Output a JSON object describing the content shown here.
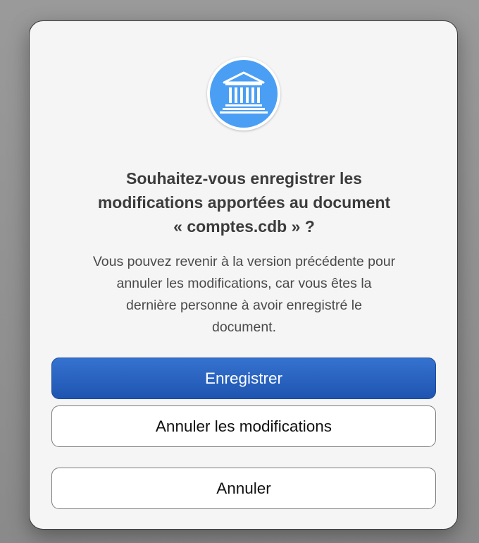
{
  "dialog": {
    "title": "Souhaitez-vous enregistrer les\nmodifications apportées au document\n« comptes.cdb » ?",
    "message": "Vous pouvez revenir à la version précédente pour\nannuler les modifications, car vous êtes la\ndernière personne à avoir enregistré le\ndocument.",
    "icon": "bank-building-icon",
    "buttons": {
      "save": "Enregistrer",
      "discard": "Annuler les modifications",
      "cancel": "Annuler"
    }
  },
  "colors": {
    "accent": "#2a63c0",
    "icon_background": "#4a9ff5"
  }
}
